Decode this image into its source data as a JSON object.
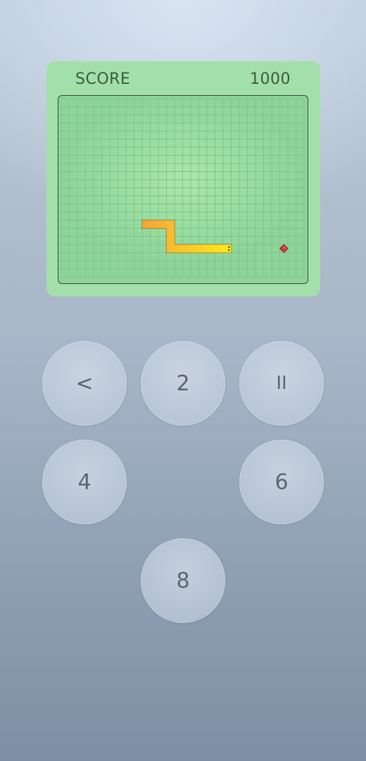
{
  "header": {
    "score_label": "SCORE",
    "score_value": "1000"
  },
  "game": {
    "cols": 30,
    "rows": 22,
    "snake_body_color": "#f5a33a",
    "snake_head_color": "#ffe21f",
    "food_color": "#d93a32",
    "food": [
      27,
      18
    ],
    "snake": [
      [
        10,
        15
      ],
      [
        11,
        15
      ],
      [
        12,
        15
      ],
      [
        13,
        15
      ],
      [
        13,
        16
      ],
      [
        13,
        17
      ],
      [
        13,
        18
      ],
      [
        14,
        18
      ],
      [
        15,
        18
      ],
      [
        16,
        18
      ],
      [
        17,
        18
      ],
      [
        18,
        18
      ],
      [
        19,
        18
      ],
      [
        20,
        18
      ]
    ]
  },
  "controls": {
    "back": "<",
    "up": "2",
    "pause": "II",
    "left": "4",
    "right": "6",
    "down": "8"
  }
}
